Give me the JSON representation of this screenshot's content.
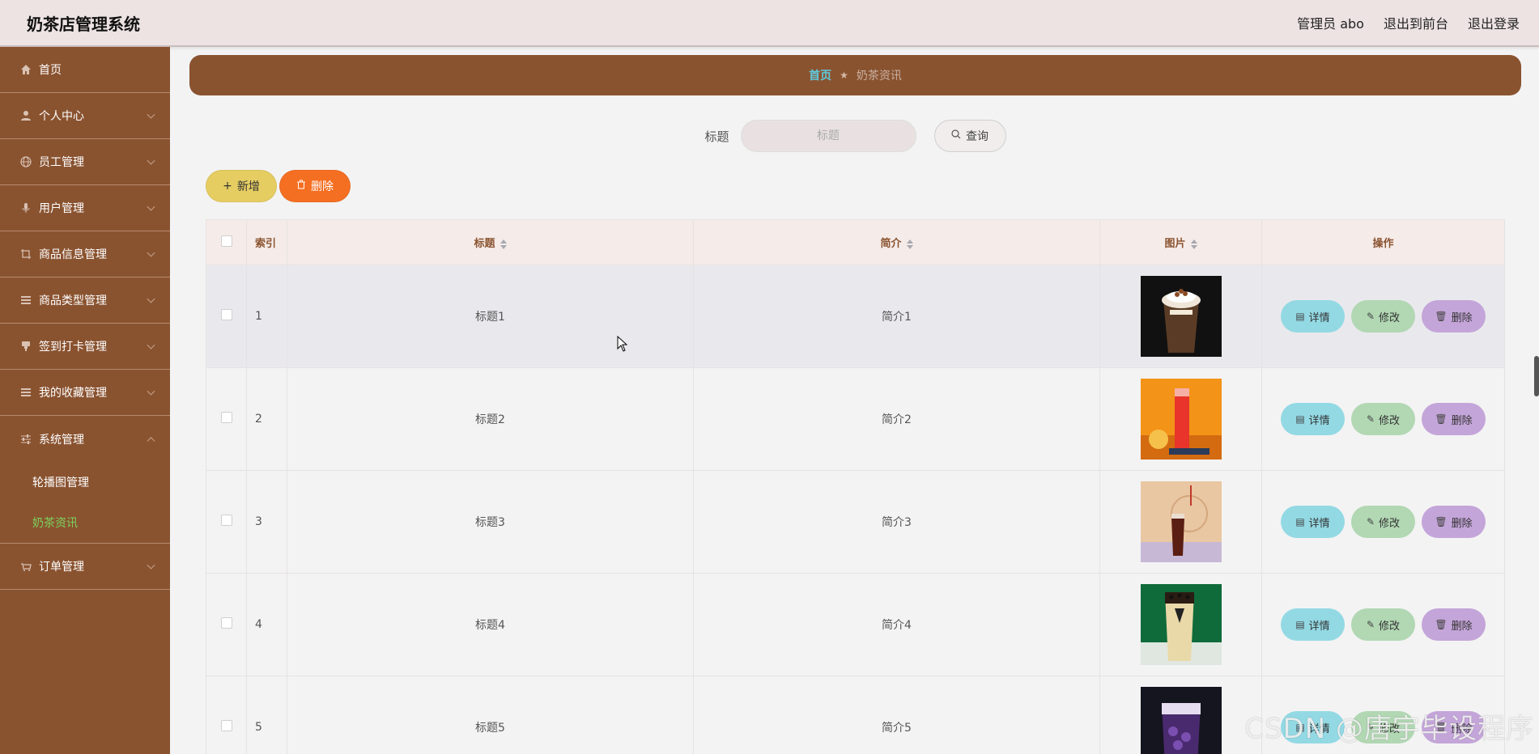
{
  "header": {
    "app_title": "奶茶店管理系统",
    "admin_label": "管理员 abo",
    "to_front": "退出到前台",
    "logout": "退出登录"
  },
  "sidebar": {
    "items": [
      {
        "label": "首页",
        "icon": "home-icon"
      },
      {
        "label": "个人中心",
        "icon": "user-icon"
      },
      {
        "label": "员工管理",
        "icon": "globe-icon"
      },
      {
        "label": "用户管理",
        "icon": "mic-icon"
      },
      {
        "label": "商品信息管理",
        "icon": "crop-icon"
      },
      {
        "label": "商品类型管理",
        "icon": "list-icon"
      },
      {
        "label": "签到打卡管理",
        "icon": "stamp-icon"
      },
      {
        "label": "我的收藏管理",
        "icon": "list-icon"
      },
      {
        "label": "系统管理",
        "icon": "sliders-icon"
      },
      {
        "label": "订单管理",
        "icon": "cart-icon"
      }
    ],
    "sub_items": [
      {
        "label": "轮播图管理"
      },
      {
        "label": "奶茶资讯"
      }
    ]
  },
  "breadcrumb": {
    "home": "首页",
    "current": "奶茶资讯"
  },
  "search": {
    "label": "标题",
    "placeholder": "标题",
    "query_label": "查询"
  },
  "actions": {
    "add_label": "新增",
    "delete_label": "删除"
  },
  "table": {
    "headers": {
      "index": "索引",
      "title": "标题",
      "summary": "简介",
      "image": "图片",
      "ops": "操作"
    },
    "op_labels": {
      "detail": "详情",
      "edit": "修改",
      "delete": "删除"
    },
    "rows": [
      {
        "index": "1",
        "title": "标题1",
        "summary": "简介1"
      },
      {
        "index": "2",
        "title": "标题2",
        "summary": "简介2"
      },
      {
        "index": "3",
        "title": "标题3",
        "summary": "简介3"
      },
      {
        "index": "4",
        "title": "标题4",
        "summary": "简介4"
      },
      {
        "index": "5",
        "title": "标题5",
        "summary": "简介5"
      }
    ]
  },
  "watermark": "CSDN @唐宇毕设程序",
  "colors": {
    "sidebar_bg": "#8a5330",
    "header_bg": "#ede3e3",
    "active_sub": "#7bd35c",
    "add_btn": "#e6cd62",
    "delete_btn": "#f56f22",
    "detail_btn": "#93d9e4",
    "edit_btn": "#b1d7b3",
    "op_delete_btn": "#c4a5d9"
  }
}
